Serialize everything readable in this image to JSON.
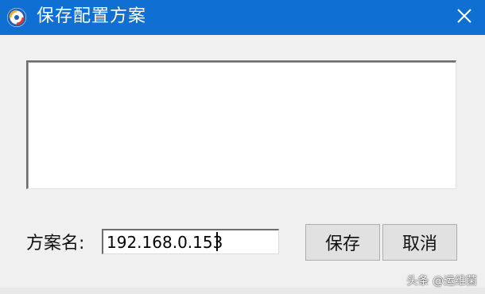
{
  "window": {
    "title": "保存配置方案",
    "icons": {
      "app": "app-logo-icon",
      "close": "close-icon"
    }
  },
  "form": {
    "name_label": "方案名:",
    "name_value": "192.168.0.153"
  },
  "buttons": {
    "save_label": "保存",
    "cancel_label": "取消"
  },
  "watermark": "头条 @运维菌",
  "colors": {
    "titlebar": "#0f6fd2",
    "title_text": "#ffffff",
    "client_bg": "#f0f0f0",
    "button_bg": "#e1e1e1"
  }
}
